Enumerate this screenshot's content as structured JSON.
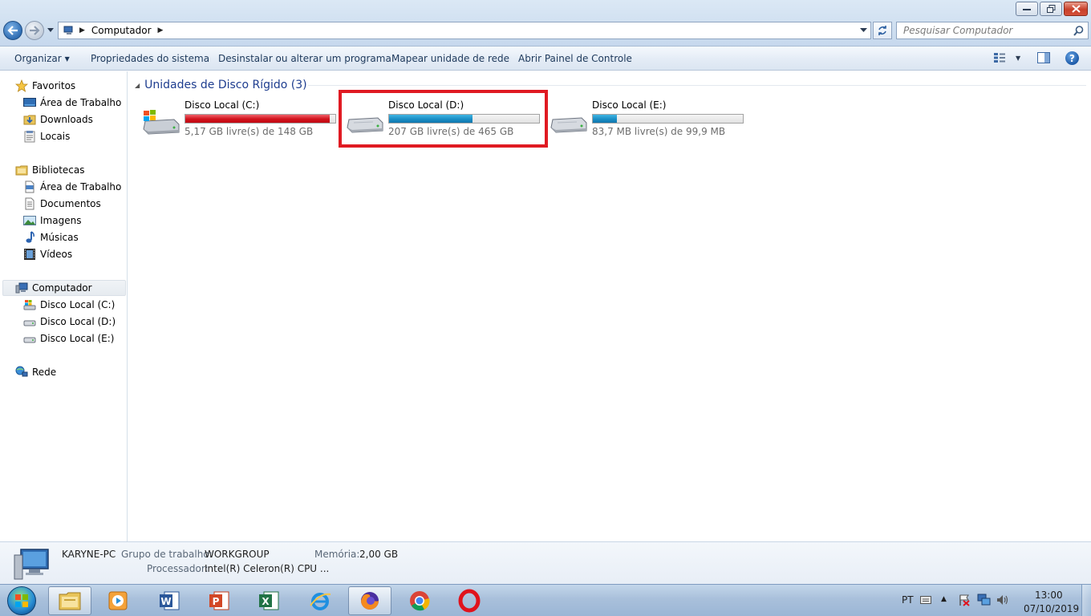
{
  "window": {
    "address": {
      "crumb": "Computador"
    },
    "search": {
      "placeholder": "Pesquisar Computador"
    }
  },
  "toolbar": {
    "organize": "Organizar",
    "system_properties": "Propriedades do sistema",
    "uninstall": "Desinstalar ou alterar um programa",
    "map_drive": "Mapear unidade de rede",
    "control_panel": "Abrir Painel de Controle",
    "help": "?"
  },
  "nav": {
    "favorites": {
      "label": "Favoritos",
      "items": [
        "Área de Trabalho",
        "Downloads",
        "Locais"
      ]
    },
    "libraries": {
      "label": "Bibliotecas",
      "items": [
        "Área de Trabalho",
        "Documentos",
        "Imagens",
        "Músicas",
        "Vídeos"
      ]
    },
    "computer": {
      "label": "Computador",
      "items": [
        "Disco Local (C:)",
        "Disco Local (D:)",
        "Disco Local (E:)"
      ]
    },
    "network": {
      "label": "Rede"
    }
  },
  "content": {
    "group_title": "Unidades de Disco Rígido (3)",
    "drives": [
      {
        "name": "Disco Local (C:)",
        "free_text": "5,17 GB livre(s) de 148 GB",
        "used_fraction": 0.965,
        "bar_color": "#d1121c",
        "icon": "windows-drive-icon"
      },
      {
        "name": "Disco Local (D:)",
        "free_text": "207 GB livre(s) de 465 GB",
        "used_fraction": 0.555,
        "bar_color": "#1a8fc6",
        "icon": "hard-drive-icon",
        "highlighted": true,
        "highlight_color": "#e01a22"
      },
      {
        "name": "Disco Local (E:)",
        "free_text": "83,7 MB livre(s) de 99,9 MB",
        "used_fraction": 0.162,
        "bar_color": "#1a8fc6",
        "icon": "hard-drive-icon"
      }
    ]
  },
  "details": {
    "pc_name": "KARYNE-PC",
    "workgroup_label": "Grupo de trabalho:",
    "workgroup_value": "WORKGROUP",
    "memory_label": "Memória:",
    "memory_value": "2,00 GB",
    "processor_label": "Processador:",
    "processor_value": "Intel(R) Celeron(R) CPU ..."
  },
  "taskbar": {
    "apps": [
      "windows-explorer-icon",
      "media-player-icon",
      "word-icon",
      "powerpoint-icon",
      "excel-icon",
      "internet-explorer-icon",
      "firefox-icon",
      "chrome-icon",
      "opera-icon"
    ],
    "language": "PT",
    "time": "13:00",
    "date": "07/10/2019"
  }
}
